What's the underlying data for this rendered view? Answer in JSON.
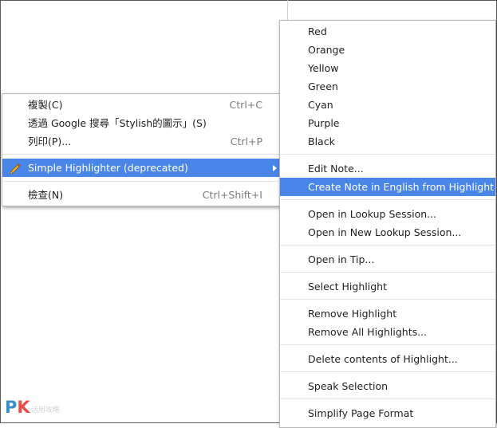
{
  "context_menu": {
    "items": [
      {
        "label": "複製(C)",
        "shortcut": "Ctrl+C"
      },
      {
        "label": "透過 Google 搜尋「Stylish的圖示」(S)",
        "shortcut": ""
      },
      {
        "label": "列印(P)...",
        "shortcut": "Ctrl+P"
      },
      {
        "label": "Simple Highlighter (deprecated)",
        "shortcut": ""
      },
      {
        "label": "檢查(N)",
        "shortcut": "Ctrl+Shift+I"
      }
    ]
  },
  "submenu": {
    "items": [
      {
        "label": "Red"
      },
      {
        "label": "Orange"
      },
      {
        "label": "Yellow"
      },
      {
        "label": "Green"
      },
      {
        "label": "Cyan"
      },
      {
        "label": "Purple"
      },
      {
        "label": "Black"
      },
      {
        "label": "Edit Note..."
      },
      {
        "label": "Create Note in English from Highlight"
      },
      {
        "label": "Open in Lookup Session..."
      },
      {
        "label": "Open in New Lookup Session..."
      },
      {
        "label": "Open in Tip..."
      },
      {
        "label": "Select Highlight"
      },
      {
        "label": "Remove Highlight"
      },
      {
        "label": "Remove All Highlights..."
      },
      {
        "label": "Delete contents of Highlight..."
      },
      {
        "label": "Speak Selection"
      },
      {
        "label": "Simplify Page Format"
      }
    ]
  },
  "watermark": {
    "p": "P",
    "k": "K",
    "small": "活用攻略"
  },
  "colors": {
    "highlight": "#4a86e8",
    "pencil": "#f2b233"
  },
  "icons": {
    "extension": "pencil-icon",
    "submenu_arrow": "chevron-right-icon"
  }
}
